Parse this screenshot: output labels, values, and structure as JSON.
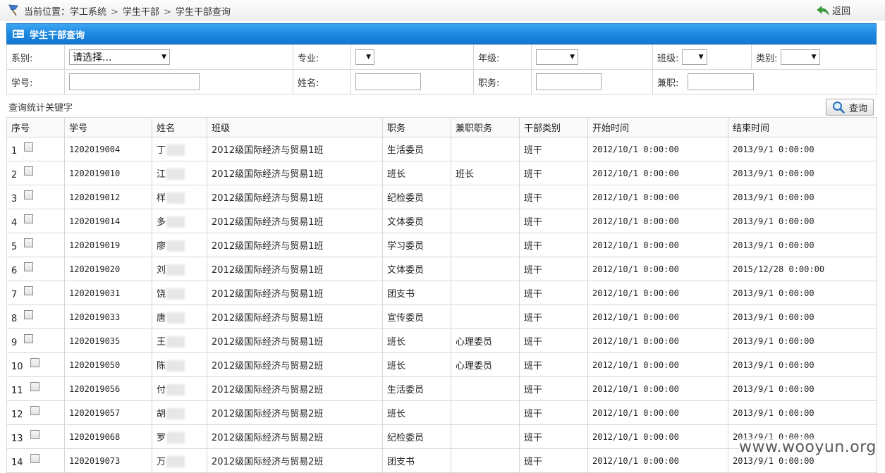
{
  "breadcrumb": {
    "prefix": "当前位置：",
    "items": [
      "学工系统",
      "学生干部",
      "学生干部查询"
    ],
    "separator": ">"
  },
  "back_label": "返回",
  "panel_title": "学生干部查询",
  "filters": {
    "dept_label": "系别:",
    "dept_value": "请选择...",
    "major_label": "专业:",
    "major_value": "",
    "grade_label": "年级:",
    "grade_value": "",
    "class_label": "班级:",
    "class_value": "",
    "category_label": "类别:",
    "category_value": "",
    "student_id_label": "学号:",
    "student_id_value": "",
    "name_label": "姓名:",
    "name_value": "",
    "position_label": "职务:",
    "position_value": "",
    "concurrent_label": "兼职:",
    "concurrent_value": ""
  },
  "keyword_label": "查询统计关键字",
  "query_button": "查询",
  "columns": [
    "序号",
    "学号",
    "姓名",
    "班级",
    "职务",
    "兼职职务",
    "干部类别",
    "开始时间",
    "结束时间"
  ],
  "rows": [
    {
      "seq": "1",
      "id": "1202019004",
      "name": "丁",
      "class": "2012级国际经济与贸易1班",
      "position": "生活委员",
      "concurrent": "",
      "category": "班干",
      "start": "2012/10/1 0:00:00",
      "end": "2013/9/1 0:00:00"
    },
    {
      "seq": "2",
      "id": "1202019010",
      "name": "江",
      "class": "2012级国际经济与贸易1班",
      "position": "班长",
      "concurrent": "班长",
      "category": "班干",
      "start": "2012/10/1 0:00:00",
      "end": "2013/9/1 0:00:00"
    },
    {
      "seq": "3",
      "id": "1202019012",
      "name": "样",
      "class": "2012级国际经济与贸易1班",
      "position": "纪检委员",
      "concurrent": "",
      "category": "班干",
      "start": "2012/10/1 0:00:00",
      "end": "2013/9/1 0:00:00"
    },
    {
      "seq": "4",
      "id": "1202019014",
      "name": "多",
      "class": "2012级国际经济与贸易1班",
      "position": "文体委员",
      "concurrent": "",
      "category": "班干",
      "start": "2012/10/1 0:00:00",
      "end": "2013/9/1 0:00:00"
    },
    {
      "seq": "5",
      "id": "1202019019",
      "name": "廖",
      "class": "2012级国际经济与贸易1班",
      "position": "学习委员",
      "concurrent": "",
      "category": "班干",
      "start": "2012/10/1 0:00:00",
      "end": "2013/9/1 0:00:00"
    },
    {
      "seq": "6",
      "id": "1202019020",
      "name": "刘",
      "class": "2012级国际经济与贸易1班",
      "position": "文体委员",
      "concurrent": "",
      "category": "班干",
      "start": "2012/10/1 0:00:00",
      "end": "2015/12/28 0:00:00"
    },
    {
      "seq": "7",
      "id": "1202019031",
      "name": "饶",
      "class": "2012级国际经济与贸易1班",
      "position": "团支书",
      "concurrent": "",
      "category": "班干",
      "start": "2012/10/1 0:00:00",
      "end": "2013/9/1 0:00:00"
    },
    {
      "seq": "8",
      "id": "1202019033",
      "name": "唐",
      "class": "2012级国际经济与贸易1班",
      "position": "宣传委员",
      "concurrent": "",
      "category": "班干",
      "start": "2012/10/1 0:00:00",
      "end": "2013/9/1 0:00:00"
    },
    {
      "seq": "9",
      "id": "1202019035",
      "name": "王",
      "class": "2012级国际经济与贸易1班",
      "position": "班长",
      "concurrent": "心理委员",
      "category": "班干",
      "start": "2012/10/1 0:00:00",
      "end": "2013/9/1 0:00:00"
    },
    {
      "seq": "10",
      "id": "1202019050",
      "name": "陈",
      "class": "2012级国际经济与贸易2班",
      "position": "班长",
      "concurrent": "心理委员",
      "category": "班干",
      "start": "2012/10/1 0:00:00",
      "end": "2013/9/1 0:00:00"
    },
    {
      "seq": "11",
      "id": "1202019056",
      "name": "付",
      "class": "2012级国际经济与贸易2班",
      "position": "生活委员",
      "concurrent": "",
      "category": "班干",
      "start": "2012/10/1 0:00:00",
      "end": "2013/9/1 0:00:00"
    },
    {
      "seq": "12",
      "id": "1202019057",
      "name": "胡",
      "class": "2012级国际经济与贸易2班",
      "position": "班长",
      "concurrent": "",
      "category": "班干",
      "start": "2012/10/1 0:00:00",
      "end": "2013/9/1 0:00:00"
    },
    {
      "seq": "13",
      "id": "1202019068",
      "name": "罗",
      "class": "2012级国际经济与贸易2班",
      "position": "纪检委员",
      "concurrent": "",
      "category": "班干",
      "start": "2012/10/1 0:00:00",
      "end": "2013/9/1 0:00:00"
    },
    {
      "seq": "14",
      "id": "1202019073",
      "name": "万",
      "class": "2012级国际经济与贸易2班",
      "position": "团支书",
      "concurrent": "",
      "category": "班干",
      "start": "2012/10/1 0:00:00",
      "end": "2013/9/1 0:00:00"
    }
  ],
  "watermark": "www.wooyun.org",
  "colors": {
    "header_blue": "#1a87df",
    "border": "#d7d7d7"
  },
  "icons": {
    "breadcrumb": "flag-icon",
    "back": "back-arrow-icon",
    "panel": "list-icon",
    "query": "magnifier-icon"
  }
}
